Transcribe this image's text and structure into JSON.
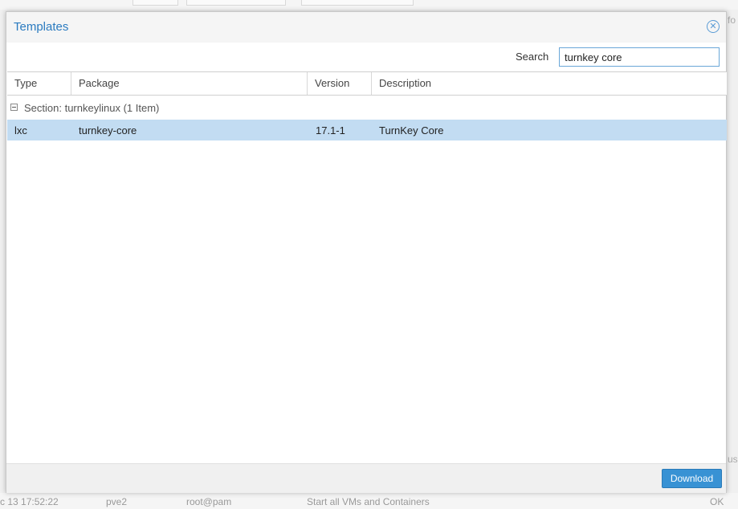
{
  "dialog": {
    "title": "Templates",
    "search_label": "Search",
    "search_value": "turnkey core",
    "download_label": "Download"
  },
  "grid": {
    "columns": [
      "Type",
      "Package",
      "Version",
      "Description"
    ],
    "group_label": "Section: turnkeylinux (1 Item)",
    "rows": [
      {
        "type": "lxc",
        "package": "turnkey-core",
        "version": "17.1-1",
        "description": "TurnKey Core"
      }
    ]
  },
  "background": {
    "status_time": "c 13 17:52:22",
    "status_node": "pve2",
    "status_user": "root@pam",
    "status_task": "Start all VMs and Containers",
    "status_result": "OK",
    "edge_top": "fo",
    "edge_mid": "us"
  },
  "colors": {
    "title_blue": "#2b7bc0",
    "selection": "#c2dcf2",
    "button_blue": "#3892d4"
  }
}
